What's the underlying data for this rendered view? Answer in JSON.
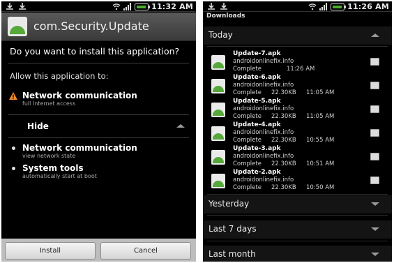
{
  "left_screen": {
    "status_time": "11:32 AM",
    "app_name": "com.Security.Update",
    "question": "Do you want to install this application?",
    "allow_heading": "Allow this application to:",
    "permissions": [
      {
        "title": "Network communication",
        "subtitle": "full Internet access"
      }
    ],
    "hide_label": "Hide",
    "hidden_permissions": [
      {
        "title": "Network communication",
        "subtitle": "view network state"
      },
      {
        "title": "System tools",
        "subtitle": "automatically start at boot"
      }
    ],
    "install_label": "Install",
    "cancel_label": "Cancel"
  },
  "right_screen": {
    "status_time": "11:26 AM",
    "title": "Downloads",
    "sections": {
      "today": "Today",
      "yesterday": "Yesterday",
      "last7": "Last 7 days",
      "lastmonth": "Last month"
    },
    "downloads": [
      {
        "name": "Update-7.apk",
        "domain": "androidonlinefix.info",
        "status": "Complete",
        "size": "",
        "time": "11:26 AM"
      },
      {
        "name": "Update-6.apk",
        "domain": "androidonlinefix.info",
        "status": "Complete",
        "size": "22.30KB",
        "time": "11:05 AM"
      },
      {
        "name": "Update-5.apk",
        "domain": "androidonlinefix.info",
        "status": "Complete",
        "size": "22.30KB",
        "time": "11:05 AM"
      },
      {
        "name": "Update-4.apk",
        "domain": "androidonlinefix.info",
        "status": "Complete",
        "size": "22.30KB",
        "time": "10:55 AM"
      },
      {
        "name": "Update-3.apk",
        "domain": "androidonlinefix.info",
        "status": "Complete",
        "size": "22.30KB",
        "time": "10:51 AM"
      },
      {
        "name": "Update-2.apk",
        "domain": "androidonlinefix.info",
        "status": "Complete",
        "size": "22.30KB",
        "time": "10:50 AM"
      }
    ]
  },
  "colors": {
    "warning": "#f08a24",
    "battery": "#4caf2c",
    "android": "#56a83a"
  }
}
